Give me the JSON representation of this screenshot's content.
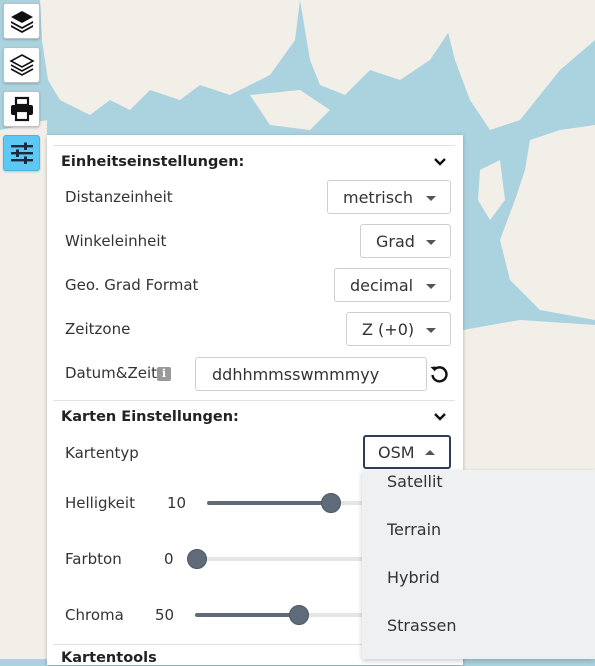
{
  "toolbar": {
    "buttons": [
      {
        "name": "layers",
        "active": false
      },
      {
        "name": "layers-outline",
        "active": false
      },
      {
        "name": "print",
        "active": false
      },
      {
        "name": "settings",
        "active": true
      }
    ]
  },
  "unit_settings": {
    "title": "Einheitseinstellungen:",
    "distance": {
      "label": "Distanzeinheit",
      "value": "metrisch"
    },
    "angle": {
      "label": "Winkeleinheit",
      "value": "Grad"
    },
    "geo_format": {
      "label": "Geo. Grad Format",
      "value": "decimal"
    },
    "timezone": {
      "label": "Zeitzone",
      "value": "Z (+0)"
    },
    "datetime": {
      "label": "Datum&Zeit",
      "value": "ddhhmmsswmmmyy",
      "info_icon": "i"
    }
  },
  "map_settings": {
    "title": "Karten Einstellungen:",
    "map_type": {
      "label": "Kartentyp",
      "value": "OSM"
    },
    "brightness": {
      "label": "Helligkeit",
      "value": "10",
      "fraction": 0.55
    },
    "hue": {
      "label": "Farbton",
      "value": "0",
      "fraction": 0.0
    },
    "chroma": {
      "label": "Chroma",
      "value": "50",
      "fraction": 0.5
    }
  },
  "next_section": {
    "title": "Kartentools"
  },
  "map_type_options": [
    "Satellit",
    "Terrain",
    "Hybrid",
    "Strassen"
  ],
  "colors": {
    "water": "#aad3df",
    "land": "#f2efe9",
    "accent": "#5bc8f5",
    "slider": "#5f6b78"
  }
}
